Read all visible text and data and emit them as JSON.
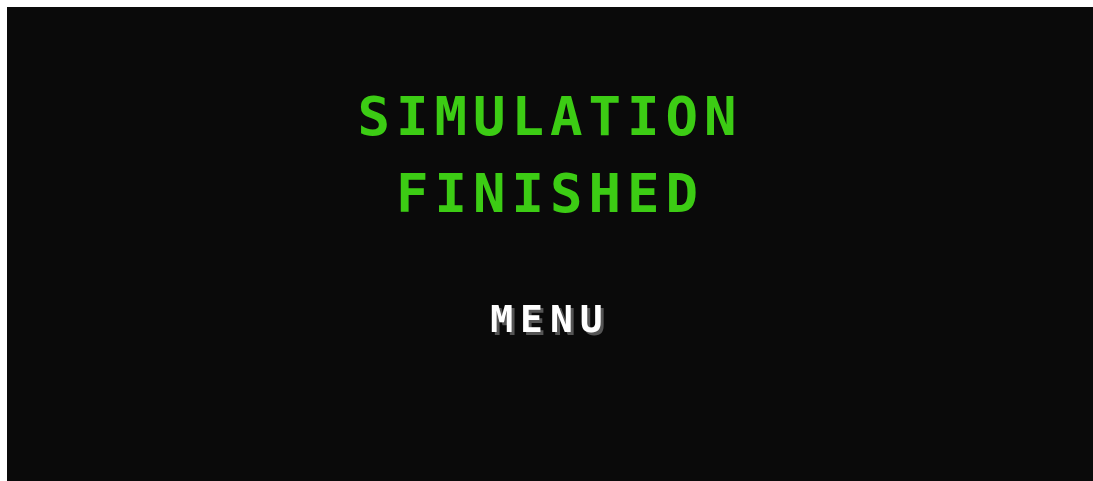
{
  "title": "SIMULATION FINISHED",
  "buttons": [
    {
      "label": "MENU"
    }
  ]
}
